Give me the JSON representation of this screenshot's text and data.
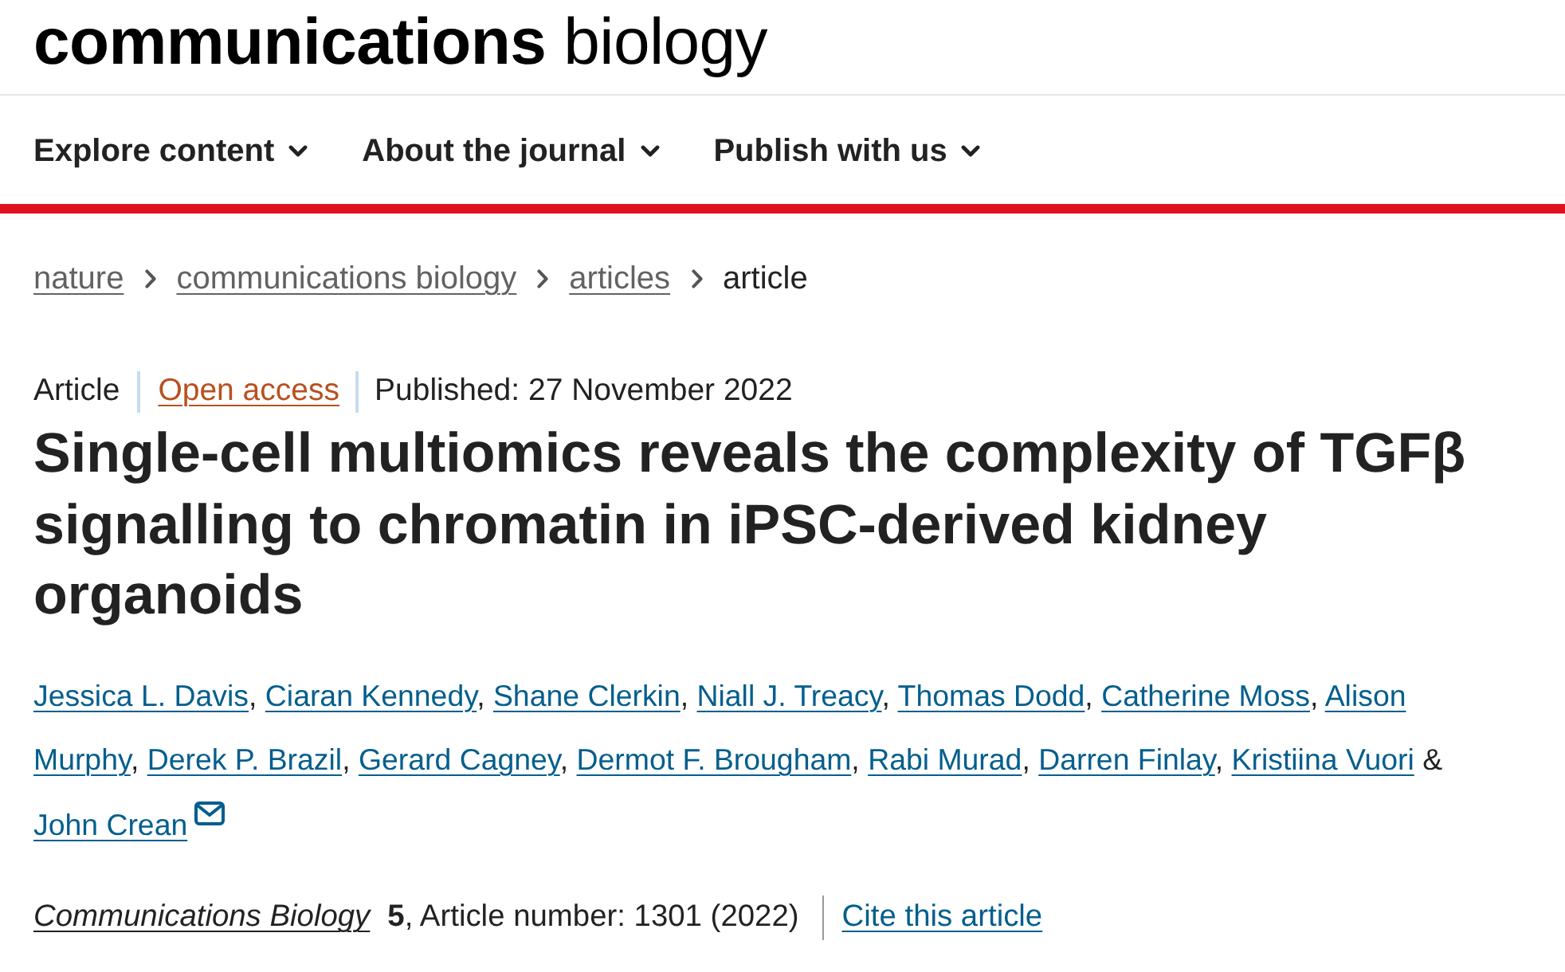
{
  "header": {
    "logo": "**communications** biology"
  },
  "nav": [
    {
      "label": "Explore content"
    },
    {
      "label": "About the journal"
    },
    {
      "label": "Publish with us"
    }
  ],
  "breadcrumbs": [
    {
      "label": "nature",
      "current": false
    },
    {
      "label": "communications biology",
      "current": false
    },
    {
      "label": "articles",
      "current": false
    },
    {
      "label": "article",
      "current": true
    }
  ],
  "article": {
    "article_type": "Article",
    "access": "Open access",
    "published": "Published: 27 November 2022",
    "title": "Single-cell multiomics reveals the complexity of TGFβ signalling to chromatin in iPSC-derived kidney organoids",
    "authors": [
      {
        "name": "Jessica L. Davis",
        "separator": ",",
        "contact": false
      },
      {
        "name": "Ciaran Kennedy",
        "separator": ",",
        "contact": false
      },
      {
        "name": "Shane Clerkin",
        "separator": ",",
        "contact": false
      },
      {
        "name": "Niall J. Treacy",
        "separator": ",",
        "contact": false
      },
      {
        "name": "Thomas Dodd",
        "separator": ",",
        "contact": false
      },
      {
        "name": "Catherine Moss",
        "separator": ",",
        "contact": false
      },
      {
        "name_lines": [
          "Alison",
          "Murphy"
        ],
        "separator": ",",
        "contact": false
      },
      {
        "name": "Derek P. Brazil",
        "separator": ",",
        "contact": false
      },
      {
        "name": "Gerard Cagney",
        "separator": ",",
        "contact": false
      },
      {
        "name": "Dermot F. Brougham",
        "separator": ",",
        "contact": false
      },
      {
        "name": "Rabi Murad",
        "separator": ",",
        "contact": false
      },
      {
        "name": "Darren Finlay",
        "separator": ",",
        "contact": false
      },
      {
        "name": "Kristiina Vuori",
        "separator": "&",
        "contact": false
      },
      {
        "name": "John Crean",
        "contact": true
      }
    ],
    "citation": {
      "journal": "Communications Biology",
      "details": "**5**, Article number: 1301 (2022)",
      "cite_link": "Cite this article"
    }
  }
}
